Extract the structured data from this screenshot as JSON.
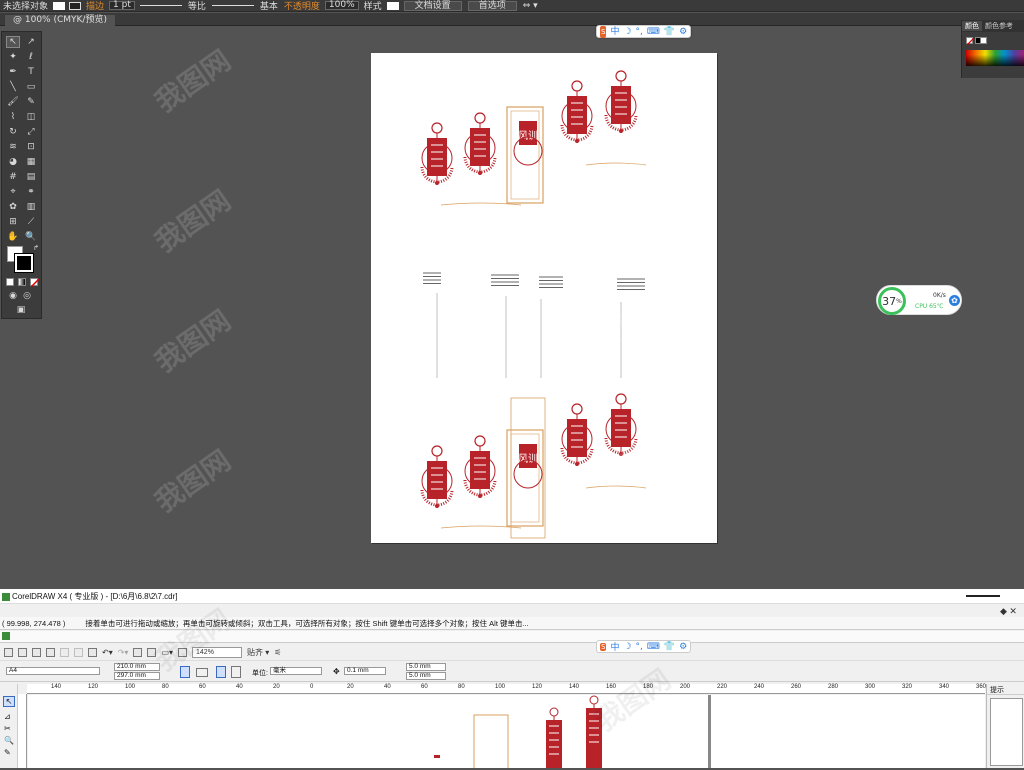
{
  "illustrator": {
    "control_bar": {
      "selection_state": "未选择对象",
      "stroke_label": "描边",
      "stroke_weight": "1 pt",
      "stroke_profile": "等比",
      "brush": "基本",
      "opacity_label": "不透明度",
      "opacity_value": "100%",
      "style_label": "样式",
      "doc_setup_button": "文档设置",
      "preferences_button": "首选项"
    },
    "doc_tab": "@ 100% (CMYK/预览)",
    "right_panel": {
      "tab_color": "颜色",
      "tab_color_guide": "颜色参考"
    }
  },
  "float_toolbar": {
    "logo": "S",
    "items": [
      "中",
      "☽",
      "°,",
      "⌨",
      "👕",
      "⚙"
    ]
  },
  "system_monitor": {
    "percent": "37",
    "percent_unit": "%",
    "net_speed": "0K/s",
    "cpu_label": "CPU 65℃"
  },
  "watermark": "我图网",
  "coreldraw": {
    "title": "CorelDRAW X4 ( 专业版 ) - [D:\\6月\\6.8\\2\\7.cdr]",
    "coords": "( 99.998, 274.478 )",
    "status_message": "接着单击可进行拖动或缩放；再单击可旋转或倾斜；双击工具，可选择所有对象；按住 Shift 键单击可选择多个对象；按住 Alt 键单击...",
    "zoom": "142%",
    "snap_label": "贴齐",
    "paper": "A4",
    "width": "210.0 mm",
    "height": "297.0 mm",
    "unit_label": "单位:",
    "unit_value": "毫米",
    "nudge": "0.1 mm",
    "dup_x": "5.0 mm",
    "dup_y": "5.0 mm",
    "docker_title": "提示",
    "ruler_ticks": [
      "140",
      "120",
      "100",
      "80",
      "60",
      "40",
      "20",
      "0",
      "20",
      "40",
      "60",
      "80",
      "100",
      "120",
      "140",
      "160",
      "180",
      "200",
      "220",
      "240",
      "260",
      "280",
      "300",
      "320",
      "340",
      "360"
    ]
  },
  "colors": {
    "ai_bg": "#535353",
    "panel": "#3c3c3c",
    "accent_orange": "#e08a2c",
    "design_red": "#b8232a",
    "design_gold": "#d8a060",
    "monitor_green": "#3cc15a",
    "float_blue": "#2b7de0"
  },
  "artwork_labels": {
    "banner_a": "风训",
    "banner_b": "风训"
  }
}
